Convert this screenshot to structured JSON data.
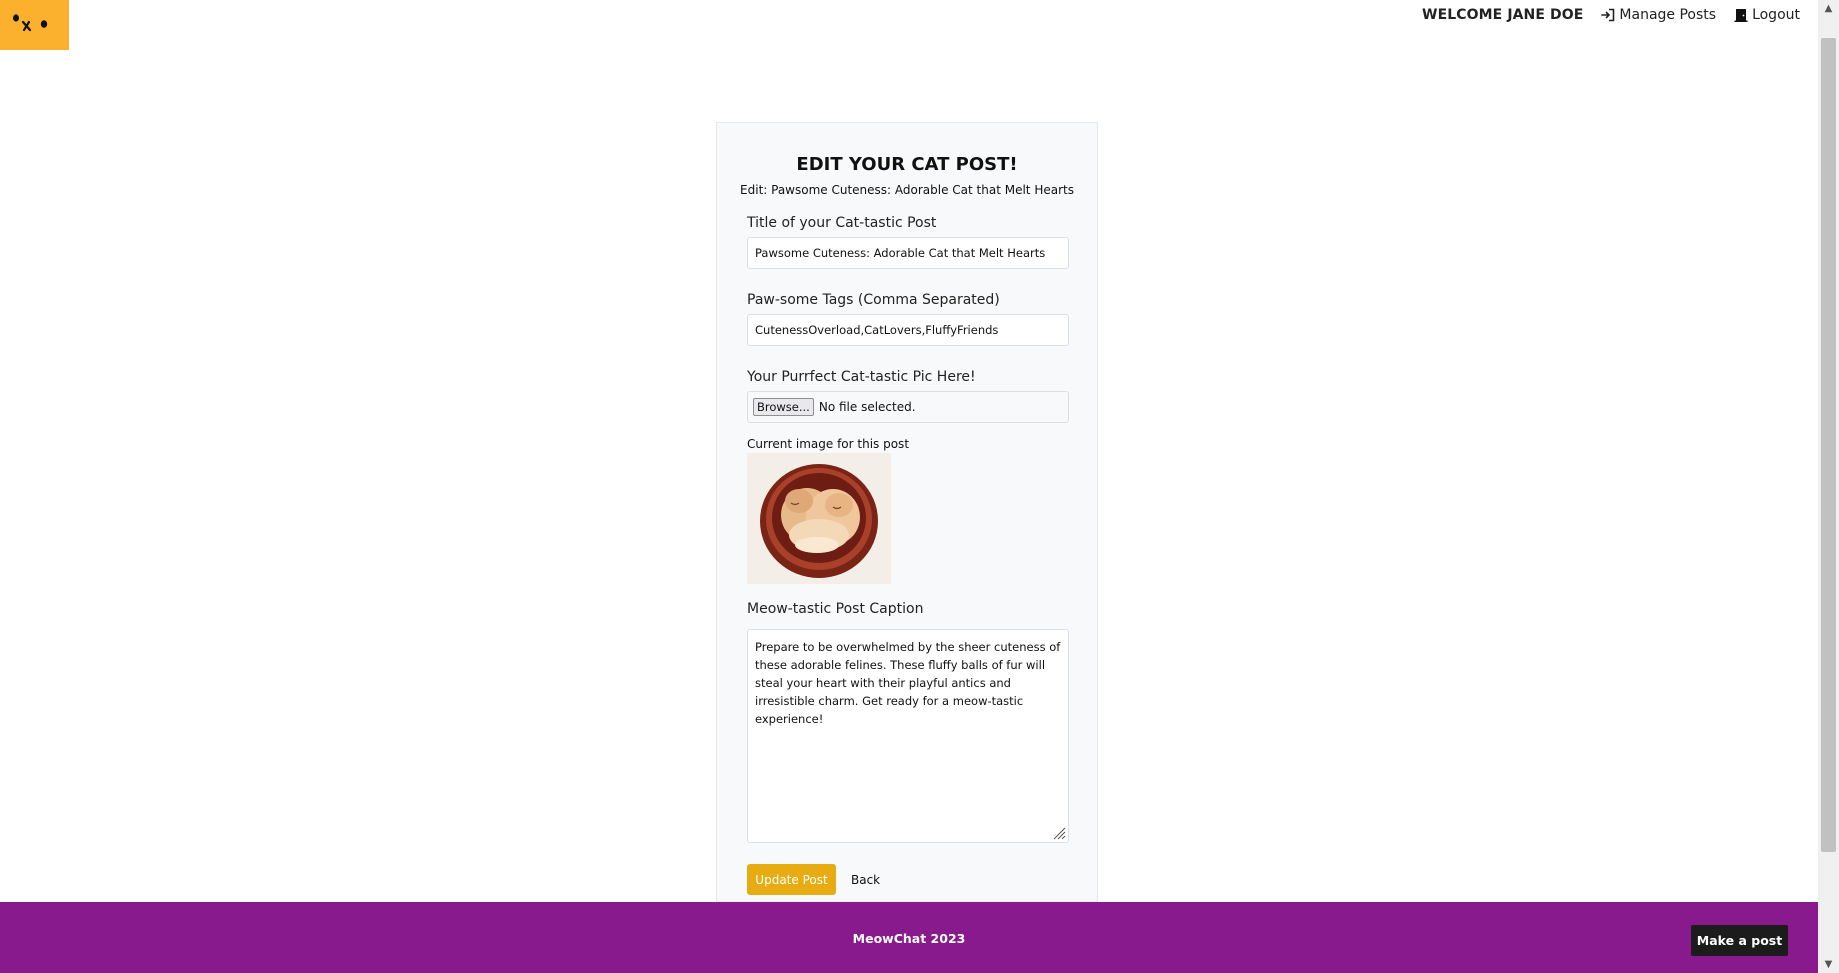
{
  "nav": {
    "welcome": "WELCOME JANE DOE",
    "manage_posts": "Manage Posts",
    "logout": "Logout"
  },
  "form": {
    "heading": "EDIT YOUR CAT POST!",
    "subheading": "Edit: Pawsome Cuteness: Adorable Cat that Melt Hearts",
    "title_label": "Title of your Cat-tastic Post",
    "title_value": "Pawsome Cuteness: Adorable Cat that Melt Hearts",
    "tags_label": "Paw-some Tags (Comma Separated)",
    "tags_value": "CutenessOverload,CatLovers,FluffyFriends",
    "pic_label": "Your Purrfect Cat-tastic Pic Here!",
    "browse_label": "Browse...",
    "file_status": "No file selected.",
    "current_image_label": "Current image for this post",
    "caption_label": "Meow-tastic Post Caption",
    "caption_value": "Prepare to be overwhelmed by the sheer cuteness of these adorable felines. These fluffy balls of fur will steal your heart with their playful antics and irresistible charm. Get ready for a meow-tastic experience!",
    "update_button": "Update Post",
    "back_link": "Back"
  },
  "footer": {
    "text": "MeowChat 2023",
    "make_post": "Make a post"
  },
  "colors": {
    "logo_bg": "#fbb12d",
    "footer_bg": "#891a8d",
    "update_button": "#e7ac12",
    "make_post_bg": "#1c1c1c"
  },
  "icons": {
    "logo": "cat-face-icon",
    "manage_posts": "sign-in-icon",
    "logout": "door-icon"
  }
}
